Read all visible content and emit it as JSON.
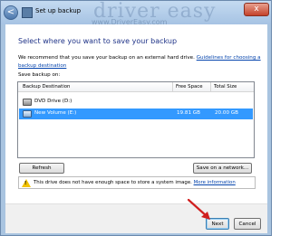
{
  "window": {
    "title": "Set up backup",
    "watermark": "driver easy",
    "watermark_url": "www.DriverEasy.com",
    "close_label": "x",
    "back_label": "<"
  },
  "content": {
    "heading": "Select where you want to save your backup",
    "recommend_text": "We recommend that you save your backup on an external hard drive. ",
    "recommend_link": "Guidelines for choosing a backup destination",
    "save_label": "Save backup on:"
  },
  "list": {
    "headers": [
      "Backup Destination",
      "Free Space",
      "Total Size"
    ],
    "rows": [
      {
        "name": "DVD Drive (D:)",
        "free": "",
        "total": "",
        "icon": "dvd-drive-icon"
      },
      {
        "name": "New Volume (E:)",
        "free": "19.81 GB",
        "total": "20.00 GB",
        "icon": "hard-drive-icon",
        "selected": true
      }
    ]
  },
  "buttons": {
    "refresh": "Refresh",
    "save_network": "Save on a network...",
    "next": "Next",
    "cancel": "Cancel"
  },
  "warning": {
    "text": "This drive does not have enough space to store a system image. ",
    "link": "More information"
  },
  "colors": {
    "heading": "#1e3287",
    "selection": "#3399ff",
    "annotation_arrow": "#d01f1f"
  }
}
